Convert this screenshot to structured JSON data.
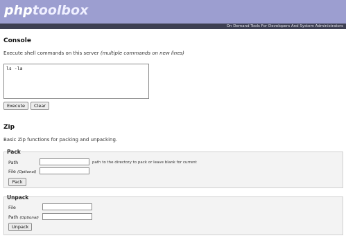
{
  "header": {
    "logo_php": "php",
    "logo_toolbox": "toolbox",
    "tagline": "On Demand Tools For Developers And System Administrators"
  },
  "console": {
    "title": "Console",
    "description": "Execute shell commands on this server",
    "description_note": "(multiple commands on new lines)",
    "textarea_value": "ls -la",
    "execute_label": "Execute",
    "clear_label": "Clear"
  },
  "zip": {
    "title": "Zip",
    "description": "Basic Zip functions for packing and unpacking.",
    "pack": {
      "legend": "Pack",
      "path_label": "Path",
      "path_value": "",
      "path_hint": "path to the directory to pack or leave blank for current",
      "file_label": "File",
      "file_optional": "(Optional)",
      "file_value": "",
      "button_label": "Pack"
    },
    "unpack": {
      "legend": "Unpack",
      "file_label": "File",
      "file_value": "",
      "path_label": "Path",
      "path_optional": "(Optional)",
      "path_value": "",
      "button_label": "Unpack"
    }
  }
}
